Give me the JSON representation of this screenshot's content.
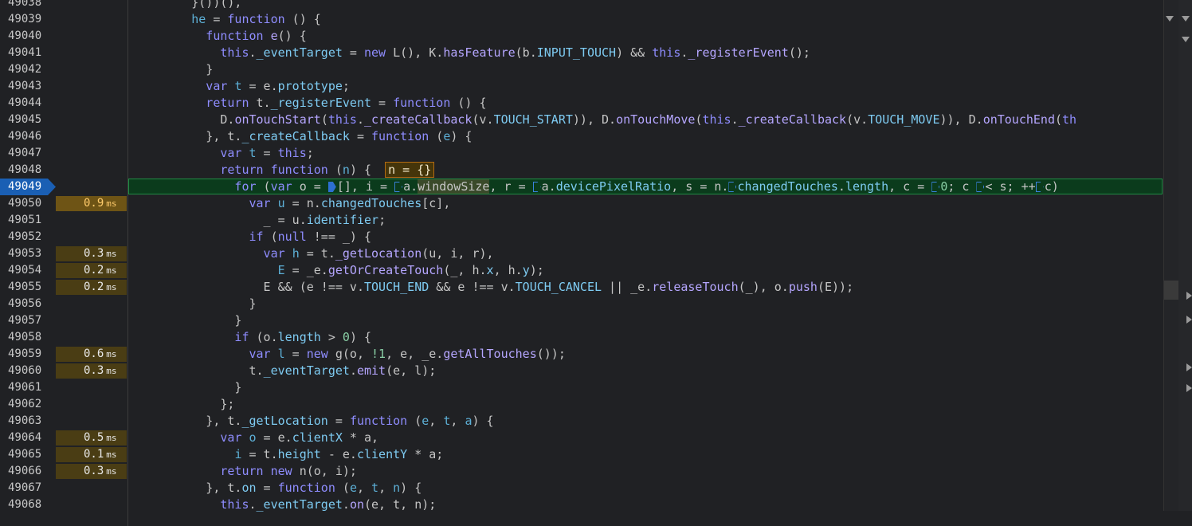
{
  "editor": {
    "paused_line": "49049",
    "lines": [
      {
        "n": "49038",
        "t": "",
        "code": [
          [
            "v",
            "        }())(),"
          ]
        ]
      },
      {
        "n": "49039",
        "t": "",
        "code": [
          [
            "kk",
            "        he"
          ],
          [
            "v",
            " = "
          ],
          [
            "k",
            "function"
          ],
          [
            "v",
            " () {"
          ]
        ]
      },
      {
        "n": "49040",
        "t": "",
        "code": [
          [
            "k",
            "          function"
          ],
          [
            "v",
            " "
          ],
          [
            "f",
            "e"
          ],
          [
            "v",
            "() {"
          ]
        ]
      },
      {
        "n": "49041",
        "t": "",
        "code": [
          [
            "k",
            "            this"
          ],
          [
            "v",
            "."
          ],
          [
            "p",
            "_eventTarget"
          ],
          [
            "v",
            " = "
          ],
          [
            "k",
            "new"
          ],
          [
            "v",
            " L(), K."
          ],
          [
            "f",
            "hasFeature"
          ],
          [
            "v",
            "(b."
          ],
          [
            "p",
            "INPUT_TOUCH"
          ],
          [
            "v",
            ") && "
          ],
          [
            "k",
            "this"
          ],
          [
            "v",
            "."
          ],
          [
            "f",
            "_registerEvent"
          ],
          [
            "v",
            "();"
          ]
        ]
      },
      {
        "n": "49042",
        "t": "",
        "code": [
          [
            "v",
            "          }"
          ]
        ]
      },
      {
        "n": "49043",
        "t": "",
        "code": [
          [
            "k",
            "          var"
          ],
          [
            "v",
            " "
          ],
          [
            "kk",
            "t"
          ],
          [
            "v",
            " = e."
          ],
          [
            "p",
            "prototype"
          ],
          [
            "v",
            ";"
          ]
        ]
      },
      {
        "n": "49044",
        "t": "",
        "code": [
          [
            "k",
            "          return"
          ],
          [
            "v",
            " t."
          ],
          [
            "p",
            "_registerEvent"
          ],
          [
            "v",
            " = "
          ],
          [
            "k",
            "function"
          ],
          [
            "v",
            " () {"
          ]
        ]
      },
      {
        "n": "49045",
        "t": "",
        "code": [
          [
            "v",
            "            D."
          ],
          [
            "f",
            "onTouchStart"
          ],
          [
            "v",
            "("
          ],
          [
            "k",
            "this"
          ],
          [
            "v",
            "."
          ],
          [
            "f",
            "_createCallback"
          ],
          [
            "v",
            "(v."
          ],
          [
            "p",
            "TOUCH_START"
          ],
          [
            "v",
            ")), D."
          ],
          [
            "f",
            "onTouchMove"
          ],
          [
            "v",
            "("
          ],
          [
            "k",
            "this"
          ],
          [
            "v",
            "."
          ],
          [
            "f",
            "_createCallback"
          ],
          [
            "v",
            "(v."
          ],
          [
            "p",
            "TOUCH_MOVE"
          ],
          [
            "v",
            ")), D."
          ],
          [
            "f",
            "onTouchEnd"
          ],
          [
            "v",
            "("
          ],
          [
            "k",
            "th"
          ]
        ]
      },
      {
        "n": "49046",
        "t": "",
        "code": [
          [
            "v",
            "          }, t."
          ],
          [
            "p",
            "_createCallback"
          ],
          [
            "v",
            " = "
          ],
          [
            "k",
            "function"
          ],
          [
            "v",
            " ("
          ],
          [
            "kk",
            "e"
          ],
          [
            "v",
            ") {"
          ]
        ]
      },
      {
        "n": "49047",
        "t": "",
        "code": [
          [
            "k",
            "            var"
          ],
          [
            "v",
            " "
          ],
          [
            "kk",
            "t"
          ],
          [
            "v",
            " = "
          ],
          [
            "k",
            "this"
          ],
          [
            "v",
            ";"
          ]
        ]
      },
      {
        "n": "49048",
        "t": "",
        "code": [
          [
            "k",
            "            return"
          ],
          [
            "v",
            " "
          ],
          [
            "k",
            "function"
          ],
          [
            "v",
            " ("
          ],
          [
            "kk",
            "n"
          ],
          [
            "v",
            ") {  "
          ],
          [
            "hl",
            "n = {}"
          ]
        ]
      },
      {
        "n": "49049",
        "t": "",
        "code": [
          [
            "k",
            "              for"
          ],
          [
            "v",
            " ("
          ],
          [
            "k",
            "var"
          ],
          [
            "v",
            " o = "
          ],
          [
            "m",
            "b"
          ],
          [
            "v",
            "[], i = "
          ],
          [
            "m",
            "o"
          ],
          [
            "v",
            "a."
          ],
          [
            "sel",
            "windowSize"
          ],
          [
            "v",
            ", r = "
          ],
          [
            "m",
            "o"
          ],
          [
            "v",
            "a."
          ],
          [
            "p",
            "devicePixelRatio"
          ],
          [
            "v",
            ", s = n."
          ],
          [
            "m",
            "o"
          ],
          [
            "p",
            "changedTouches"
          ],
          [
            "v",
            "."
          ],
          [
            "p",
            "length"
          ],
          [
            "v",
            ", c = "
          ],
          [
            "m",
            "o"
          ],
          [
            "n",
            "0"
          ],
          [
            "v",
            "; c "
          ],
          [
            "m",
            "o"
          ],
          [
            "v",
            "< s; ++"
          ],
          [
            "m",
            "o"
          ],
          [
            "v",
            "c)"
          ]
        ]
      },
      {
        "n": "49050",
        "t": "0.9",
        "hot": true,
        "code": [
          [
            "k",
            "                var"
          ],
          [
            "v",
            " "
          ],
          [
            "kk",
            "u"
          ],
          [
            "v",
            " = n."
          ],
          [
            "p",
            "changedTouches"
          ],
          [
            "v",
            "[c],"
          ]
        ]
      },
      {
        "n": "49051",
        "t": "",
        "code": [
          [
            "v",
            "                  _ = u."
          ],
          [
            "p",
            "identifier"
          ],
          [
            "v",
            ";"
          ]
        ]
      },
      {
        "n": "49052",
        "t": "",
        "code": [
          [
            "k",
            "                if"
          ],
          [
            "v",
            " ("
          ],
          [
            "k",
            "null"
          ],
          [
            "v",
            " !== _) {"
          ]
        ]
      },
      {
        "n": "49053",
        "t": "0.3",
        "code": [
          [
            "k",
            "                  var"
          ],
          [
            "v",
            " "
          ],
          [
            "kk",
            "h"
          ],
          [
            "v",
            " = t."
          ],
          [
            "f",
            "_getLocation"
          ],
          [
            "v",
            "(u, i, r),"
          ]
        ]
      },
      {
        "n": "49054",
        "t": "0.2",
        "code": [
          [
            "v",
            "                    "
          ],
          [
            "kk",
            "E"
          ],
          [
            "v",
            " = _e."
          ],
          [
            "f",
            "getOrCreateTouch"
          ],
          [
            "v",
            "(_, h."
          ],
          [
            "p",
            "x"
          ],
          [
            "v",
            ", h."
          ],
          [
            "p",
            "y"
          ],
          [
            "v",
            ");"
          ]
        ]
      },
      {
        "n": "49055",
        "t": "0.2",
        "code": [
          [
            "v",
            "                  E && (e !== v."
          ],
          [
            "p",
            "TOUCH_END"
          ],
          [
            "v",
            " && e !== v."
          ],
          [
            "p",
            "TOUCH_CANCEL"
          ],
          [
            "v",
            " || _e."
          ],
          [
            "f",
            "releaseTouch"
          ],
          [
            "v",
            "(_), o."
          ],
          [
            "f",
            "push"
          ],
          [
            "v",
            "(E));"
          ]
        ]
      },
      {
        "n": "49056",
        "t": "",
        "code": [
          [
            "v",
            "                }"
          ]
        ]
      },
      {
        "n": "49057",
        "t": "",
        "code": [
          [
            "v",
            "              }"
          ]
        ]
      },
      {
        "n": "49058",
        "t": "",
        "code": [
          [
            "k",
            "              if"
          ],
          [
            "v",
            " (o."
          ],
          [
            "p",
            "length"
          ],
          [
            "v",
            " > "
          ],
          [
            "n",
            "0"
          ],
          [
            "v",
            ") {"
          ]
        ]
      },
      {
        "n": "49059",
        "t": "0.6",
        "code": [
          [
            "k",
            "                var"
          ],
          [
            "v",
            " "
          ],
          [
            "kk",
            "l"
          ],
          [
            "v",
            " = "
          ],
          [
            "k",
            "new"
          ],
          [
            "v",
            " g(o, "
          ],
          [
            "n",
            "!1"
          ],
          [
            "v",
            ", e, _e."
          ],
          [
            "f",
            "getAllTouches"
          ],
          [
            "v",
            "());"
          ]
        ]
      },
      {
        "n": "49060",
        "t": "0.3",
        "code": [
          [
            "v",
            "                t."
          ],
          [
            "p",
            "_eventTarget"
          ],
          [
            "v",
            "."
          ],
          [
            "f",
            "emit"
          ],
          [
            "v",
            "(e, l);"
          ]
        ]
      },
      {
        "n": "49061",
        "t": "",
        "code": [
          [
            "v",
            "              }"
          ]
        ]
      },
      {
        "n": "49062",
        "t": "",
        "code": [
          [
            "v",
            "            };"
          ]
        ]
      },
      {
        "n": "49063",
        "t": "",
        "code": [
          [
            "v",
            "          }, t."
          ],
          [
            "p",
            "_getLocation"
          ],
          [
            "v",
            " = "
          ],
          [
            "k",
            "function"
          ],
          [
            "v",
            " ("
          ],
          [
            "kk",
            "e"
          ],
          [
            "v",
            ", "
          ],
          [
            "kk",
            "t"
          ],
          [
            "v",
            ", "
          ],
          [
            "kk",
            "a"
          ],
          [
            "v",
            ") {"
          ]
        ]
      },
      {
        "n": "49064",
        "t": "0.5",
        "code": [
          [
            "k",
            "            var"
          ],
          [
            "v",
            " "
          ],
          [
            "kk",
            "o"
          ],
          [
            "v",
            " = e."
          ],
          [
            "p",
            "clientX"
          ],
          [
            "v",
            " * a,"
          ]
        ]
      },
      {
        "n": "49065",
        "t": "0.1",
        "code": [
          [
            "v",
            "              "
          ],
          [
            "kk",
            "i"
          ],
          [
            "v",
            " = t."
          ],
          [
            "p",
            "height"
          ],
          [
            "v",
            " - e."
          ],
          [
            "p",
            "clientY"
          ],
          [
            "v",
            " * a;"
          ]
        ]
      },
      {
        "n": "49066",
        "t": "0.3",
        "code": [
          [
            "k",
            "            return"
          ],
          [
            "v",
            " "
          ],
          [
            "k",
            "new"
          ],
          [
            "v",
            " n(o, i);"
          ]
        ]
      },
      {
        "n": "49067",
        "t": "",
        "code": [
          [
            "v",
            "          }, t."
          ],
          [
            "p",
            "on"
          ],
          [
            "v",
            " = "
          ],
          [
            "k",
            "function"
          ],
          [
            "v",
            " ("
          ],
          [
            "kk",
            "e"
          ],
          [
            "v",
            ", "
          ],
          [
            "kk",
            "t"
          ],
          [
            "v",
            ", "
          ],
          [
            "kk",
            "n"
          ],
          [
            "v",
            ") {"
          ]
        ]
      },
      {
        "n": "49068",
        "t": "",
        "code": [
          [
            "k",
            "            this"
          ],
          [
            "v",
            "."
          ],
          [
            "p",
            "_eventTarget"
          ],
          [
            "v",
            "."
          ],
          [
            "f",
            "on"
          ],
          [
            "v",
            "(e, t, n);"
          ]
        ]
      }
    ],
    "time_unit": "ms"
  },
  "icons": {
    "scroll_up": "chevron-down-icon",
    "panel_expand": "chevron-right-icon"
  }
}
